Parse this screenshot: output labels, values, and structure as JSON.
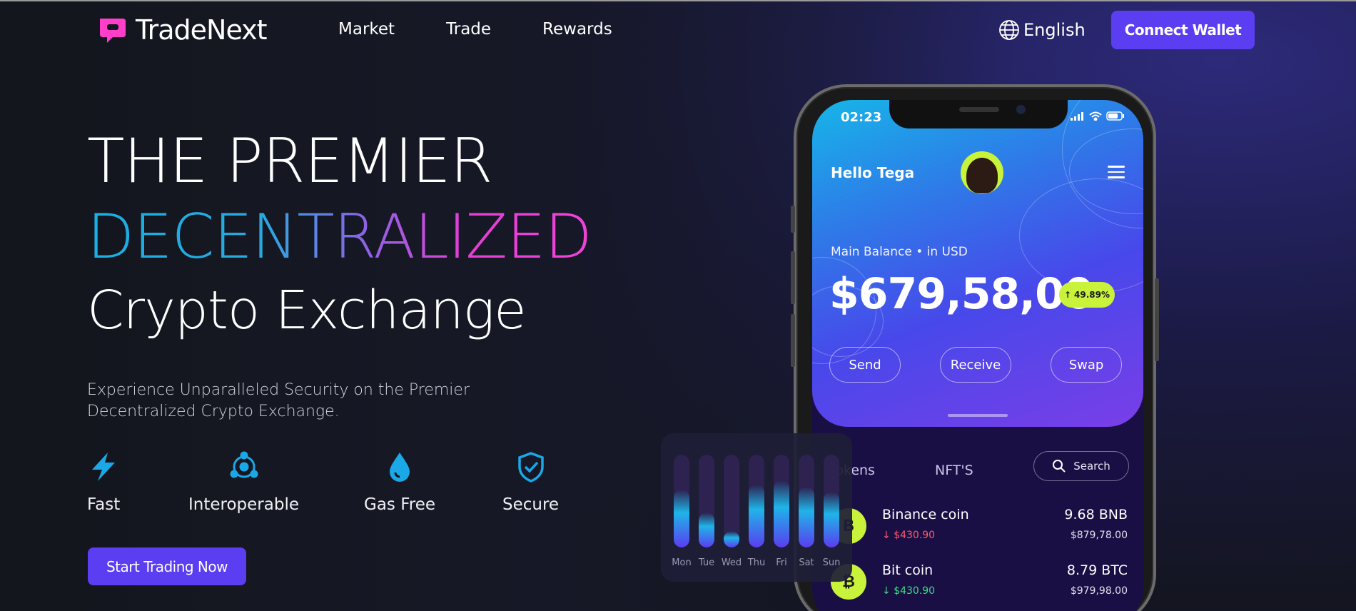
{
  "header": {
    "brand": "TradeNext",
    "nav": [
      "Market",
      "Trade",
      "Rewards"
    ],
    "language": "English",
    "connect_label": "Connect Wallet"
  },
  "hero": {
    "line1": "THE PREMIER",
    "line2": "DECENTRALIZED",
    "line3": "Crypto Exchange",
    "subtitle": "Experience Unparalleled Security on the Premier Decentralized Crypto Exchange.",
    "features": [
      {
        "label": "Fast",
        "icon": "lightning-icon"
      },
      {
        "label": "Interoperable",
        "icon": "network-icon"
      },
      {
        "label": "Gas Free",
        "icon": "drop-icon"
      },
      {
        "label": "Secure",
        "icon": "shield-check-icon"
      }
    ],
    "cta": "Start Trading Now"
  },
  "phone": {
    "time": "02:23",
    "greeting": "Hello Tega",
    "balance_label": "Main Balance",
    "balance_currency": "in USD",
    "balance": "$679,58,00",
    "change": "49.89%",
    "actions": [
      "Send",
      "Receive",
      "Swap"
    ],
    "tabs": [
      "Tokens",
      "NFT'S"
    ],
    "search_label": "Search",
    "coins": [
      {
        "name": "Binance coin",
        "symbol": "B",
        "change": "$430.90",
        "direction": "down",
        "amount": "9.68 BNB",
        "usd": "$879,78.00"
      },
      {
        "name": "Bit coin",
        "symbol": "₿",
        "change": "$430.90",
        "direction": "down",
        "amount": "8.79 BTC",
        "usd": "$979,98.00"
      }
    ]
  },
  "weekly_widget": {
    "days": [
      "Mon",
      "Tue",
      "Wed",
      "Thu",
      "Fri",
      "Sat",
      "Sun"
    ],
    "levels": [
      0.62,
      0.38,
      0.18,
      0.68,
      0.72,
      0.65,
      0.6
    ]
  },
  "colors": {
    "accent": "#5b3df2",
    "lime": "#c9f23a",
    "gradient_start": "#18b0e4",
    "gradient_end": "#f043d8",
    "down_red": "#ff5a6a",
    "down_green": "#3ddc84"
  }
}
